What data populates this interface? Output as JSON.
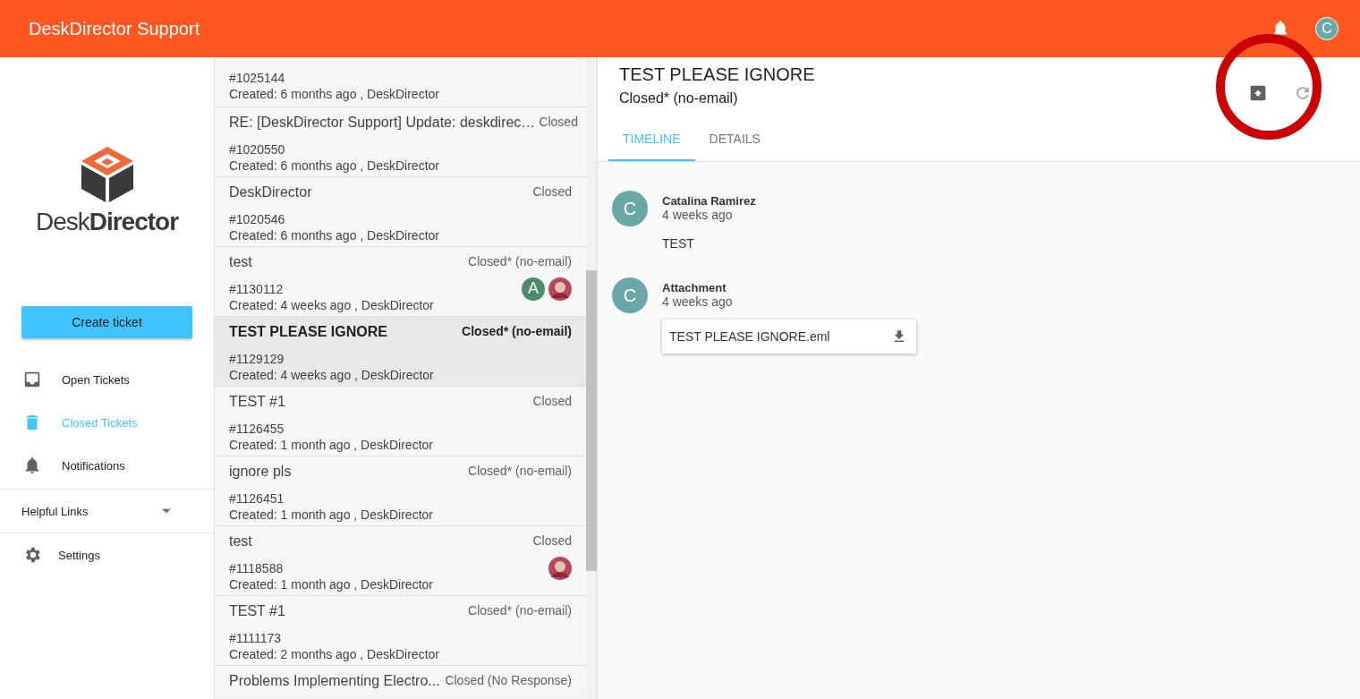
{
  "app_bar": {
    "title": "DeskDirector Support",
    "user_initial": "C"
  },
  "sidebar": {
    "logo_text_light": "Desk",
    "logo_text_bold": "Director",
    "create_button": "Create ticket",
    "items": [
      {
        "label": "Open Tickets",
        "selected": false
      },
      {
        "label": "Closed Tickets",
        "selected": true
      },
      {
        "label": "Notifications",
        "selected": false
      }
    ],
    "helpful_links": {
      "label": "Helpful Links",
      "expanded": false
    },
    "settings": {
      "label": "Settings"
    }
  },
  "tickets": [
    {
      "number": "#1025144",
      "created": "Created: 6 months ago , DeskDirector",
      "selected": false
    },
    {
      "title": "RE: [DeskDirector Support] Update: deskdirec…",
      "status": "Closed",
      "number": "#1020550",
      "created": "Created: 6 months ago , DeskDirector",
      "selected": false
    },
    {
      "title": "DeskDirector",
      "status": "Closed",
      "number": "#1020546",
      "created": "Created: 6 months ago , DeskDirector",
      "selected": false
    },
    {
      "title": "test",
      "status": "Closed* (no-email)",
      "number": "#1130112",
      "created": "Created: 4 weeks ago , DeskDirector",
      "selected": false,
      "avatars": [
        {
          "kind": "letter",
          "text": "A"
        },
        {
          "kind": "photo"
        }
      ]
    },
    {
      "title": "TEST PLEASE IGNORE",
      "status": "Closed* (no-email)",
      "number": "#1129129",
      "created": "Created: 4 weeks ago , DeskDirector",
      "selected": true
    },
    {
      "title": "TEST #1",
      "status": "Closed",
      "number": "#1126455",
      "created": "Created: 1 month ago , DeskDirector",
      "selected": false
    },
    {
      "title": "ignore pls",
      "status": "Closed* (no-email)",
      "number": "#1126451",
      "created": "Created: 1 month ago , DeskDirector",
      "selected": false
    },
    {
      "title": "test",
      "status": "Closed",
      "number": "#1118588",
      "created": "Created: 1 month ago , DeskDirector",
      "selected": false,
      "avatars": [
        {
          "kind": "photo"
        }
      ]
    },
    {
      "title": "TEST #1",
      "status": "Closed* (no-email)",
      "number": "#1111173",
      "created": "Created: 2 months ago , DeskDirector",
      "selected": false
    },
    {
      "title": "Problems Implementing Electro...",
      "status": "Closed (No Response)",
      "selected": false
    }
  ],
  "detail": {
    "title": "TEST PLEASE IGNORE",
    "status": "Closed* (no-email)",
    "tabs": [
      {
        "label": "TIMELINE",
        "selected": true
      },
      {
        "label": "DETAILS",
        "selected": false
      }
    ],
    "timeline": [
      {
        "kind": "message",
        "initial": "C",
        "author": "Catalina Ramirez",
        "time": "4 weeks ago",
        "body": "TEST"
      },
      {
        "kind": "attachment",
        "initial": "C",
        "author": "Attachment",
        "time": "4 weeks ago",
        "file": "TEST PLEASE IGNORE.eml"
      }
    ]
  }
}
